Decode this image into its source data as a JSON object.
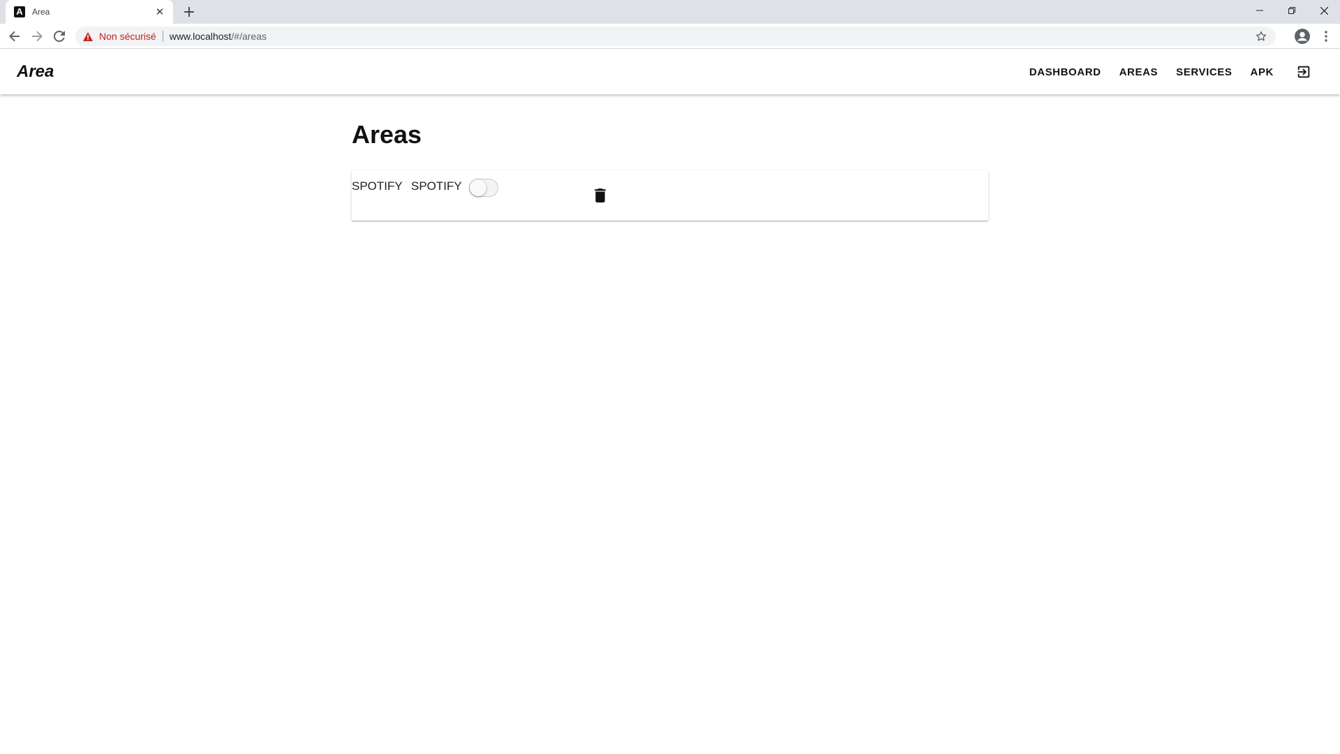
{
  "browser": {
    "tab": {
      "favicon": "A",
      "title": "Area"
    },
    "address": {
      "security_label": "Non sécurisé",
      "url_host": "www.localhost",
      "url_path": "/#/areas"
    },
    "icons": [
      "back-arrow-icon",
      "forward-arrow-icon",
      "reload-icon",
      "warning-icon",
      "star-icon",
      "profile-icon",
      "more-vert-icon",
      "minimize-icon",
      "restore-icon",
      "close-icon"
    ]
  },
  "appbar": {
    "title": "Area",
    "nav": {
      "dashboard": "DASHBOARD",
      "areas": "AREAS",
      "services": "SERVICES",
      "apk": "APK"
    },
    "logout_icon": "logout-icon"
  },
  "main": {
    "title": "Areas",
    "areas": [
      {
        "action_service": "SPOTIFY",
        "reaction_service": "SPOTIFY",
        "enabled": false,
        "delete_icon": "trash-icon"
      }
    ]
  },
  "colors": {
    "warning": "#c5221f",
    "tabstrip": "#dee1e6",
    "omnibox": "#f1f3f4"
  }
}
